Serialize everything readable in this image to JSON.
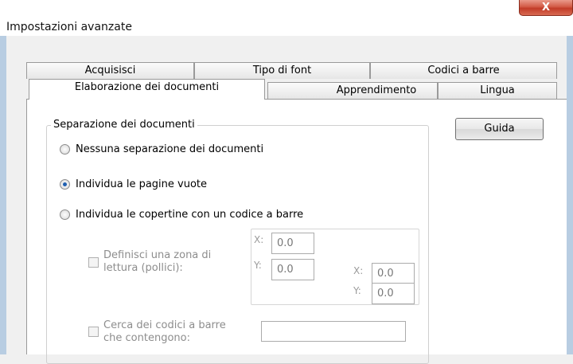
{
  "window": {
    "title": "Impostazioni avanzate",
    "close_glyph": "X"
  },
  "tabs": {
    "back_row": [
      "Acquisisci",
      "Tipo di font",
      "Codici a barre"
    ],
    "front_row": [
      "Elaborazione dei documenti",
      "Apprendimento",
      "Lingua"
    ],
    "active": "Elaborazione dei documenti"
  },
  "group": {
    "legend": "Separazione dei documenti",
    "options": [
      {
        "label": "Nessuna separazione dei documenti",
        "checked": false
      },
      {
        "label": "Individua le pagine vuote",
        "checked": true
      },
      {
        "label": "Individua le copertine con un codice a barre",
        "checked": false
      }
    ],
    "zone": {
      "label_line1": "Definisci una zona di",
      "label_line2": "lettura (pollici):",
      "x_label": "X:",
      "y_label": "Y:",
      "x1": "0.0",
      "y1": "0.0",
      "x2": "0.0",
      "y2": "0.0"
    },
    "search": {
      "label_line1": "Cerca dei codici a barre",
      "label_line2": "che contengono:",
      "value": ""
    }
  },
  "buttons": {
    "help": "Guida"
  }
}
